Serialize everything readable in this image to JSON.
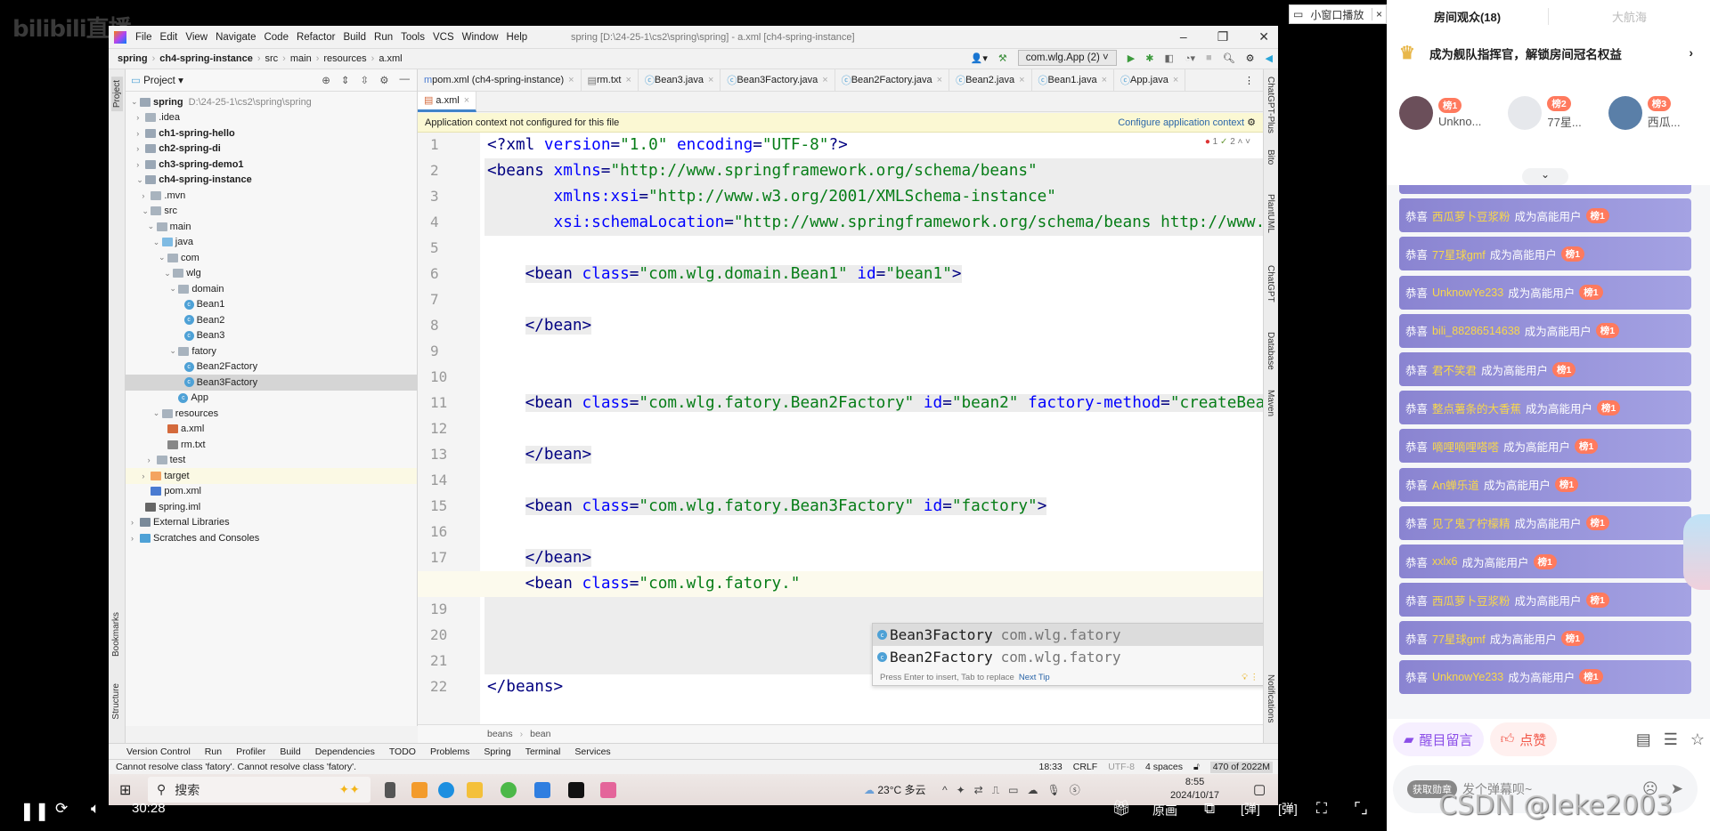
{
  "overlay": {
    "logo": "bilibili直播",
    "pip_label": "小窗口播放",
    "pip_close": "×",
    "watermark": "CSDN @leke2003"
  },
  "ide": {
    "menu": [
      "File",
      "Edit",
      "View",
      "Navigate",
      "Code",
      "Refactor",
      "Build",
      "Run",
      "Tools",
      "VCS",
      "Window",
      "Help"
    ],
    "title": "spring [D:\\24-25-1\\cs2\\spring\\spring] - a.xml [ch4-spring-instance]",
    "breadcrumb": [
      "spring",
      "ch4-spring-instance",
      "src",
      "main",
      "resources",
      "a.xml"
    ],
    "run_config": "com.wlg.App (2)",
    "project_header": "Project",
    "tree": [
      {
        "label": "spring",
        "hint": "D:\\24-25-1\\cs2\\spring\\spring",
        "lvl": 0,
        "arrow": "v",
        "icon": "module",
        "bold": true
      },
      {
        "label": ".idea",
        "lvl": 1,
        "arrow": ">",
        "icon": "folder"
      },
      {
        "label": "ch1-spring-hello",
        "lvl": 1,
        "arrow": ">",
        "icon": "module",
        "bold": true
      },
      {
        "label": "ch2-spring-di",
        "lvl": 1,
        "arrow": ">",
        "icon": "module",
        "bold": true
      },
      {
        "label": "ch3-spring-demo1",
        "lvl": 1,
        "arrow": ">",
        "icon": "module",
        "bold": true
      },
      {
        "label": "ch4-spring-instance",
        "lvl": 1,
        "arrow": "v",
        "icon": "module",
        "bold": true
      },
      {
        "label": ".mvn",
        "lvl": 2,
        "arrow": ">",
        "icon": "folder"
      },
      {
        "label": "src",
        "lvl": 2,
        "arrow": "v",
        "icon": "folder"
      },
      {
        "label": "main",
        "lvl": 3,
        "arrow": "v",
        "icon": "folder"
      },
      {
        "label": "java",
        "lvl": 4,
        "arrow": "v",
        "icon": "srcfolder"
      },
      {
        "label": "com",
        "lvl": 5,
        "arrow": "v",
        "icon": "package"
      },
      {
        "label": "wlg",
        "lvl": 6,
        "arrow": "v",
        "icon": "package"
      },
      {
        "label": "domain",
        "lvl": 7,
        "arrow": "v",
        "icon": "package"
      },
      {
        "label": "Bean1",
        "lvl": 8,
        "icon": "class"
      },
      {
        "label": "Bean2",
        "lvl": 8,
        "icon": "class"
      },
      {
        "label": "Bean3",
        "lvl": 8,
        "icon": "class"
      },
      {
        "label": "fatory",
        "lvl": 7,
        "arrow": "v",
        "icon": "package"
      },
      {
        "label": "Bean2Factory",
        "lvl": 8,
        "icon": "class"
      },
      {
        "label": "Bean3Factory",
        "lvl": 8,
        "icon": "class",
        "selected": true
      },
      {
        "label": "App",
        "lvl": 7,
        "icon": "class"
      },
      {
        "label": "resources",
        "lvl": 4,
        "arrow": "v",
        "icon": "resfolder"
      },
      {
        "label": "a.xml",
        "lvl": 5,
        "icon": "xml"
      },
      {
        "label": "rm.txt",
        "lvl": 5,
        "icon": "txt"
      },
      {
        "label": "test",
        "lvl": 3,
        "arrow": ">",
        "icon": "folder"
      },
      {
        "label": "target",
        "lvl": 2,
        "arrow": ">",
        "icon": "target",
        "target": true
      },
      {
        "label": "pom.xml",
        "lvl": 2,
        "icon": "maven"
      },
      {
        "label": "spring.iml",
        "lvl": 1,
        "icon": "iml"
      },
      {
        "label": "External Libraries",
        "lvl": 0,
        "arrow": ">",
        "icon": "libs"
      },
      {
        "label": "Scratches and Consoles",
        "lvl": 0,
        "arrow": ">",
        "icon": "scratch"
      }
    ],
    "tabs": [
      "pom.xml (ch4-spring-instance)",
      "rm.txt",
      "Bean3.java",
      "Bean3Factory.java",
      "Bean2Factory.java",
      "Bean2.java",
      "Bean1.java",
      "App.java"
    ],
    "active_tab": "a.xml",
    "banner": {
      "text": "Application context not configured for this file",
      "action": "Configure application context"
    },
    "inspections": {
      "errors": "1",
      "warnings": "2"
    },
    "code": [
      [
        [
          "pun",
          "<?"
        ],
        [
          "tag",
          "xml "
        ],
        [
          "attr",
          "version"
        ],
        [
          "pun",
          "="
        ],
        [
          "val",
          "\"1.0\" "
        ],
        [
          "attr",
          "encoding"
        ],
        [
          "pun",
          "="
        ],
        [
          "val",
          "\"UTF-8\""
        ],
        [
          "pun",
          "?>"
        ]
      ],
      [
        [
          "tag",
          "<beans "
        ],
        [
          "attr",
          "xmlns"
        ],
        [
          "pun",
          "="
        ],
        [
          "val",
          "\"http://www.springframework.org/schema/beans\""
        ]
      ],
      [
        [
          "tag",
          "       "
        ],
        [
          "attr",
          "xmlns:xsi"
        ],
        [
          "pun",
          "="
        ],
        [
          "val",
          "\"http://www.w3.org/2001/XMLSchema-instance\""
        ]
      ],
      [
        [
          "tag",
          "       "
        ],
        [
          "attr",
          "xsi:schemaLocation"
        ],
        [
          "pun",
          "="
        ],
        [
          "val",
          "\"http://www.springframework.org/schema/beans http://www.s"
        ]
      ],
      [],
      [
        [
          "tag",
          "    <bean "
        ],
        [
          "attr",
          "class"
        ],
        [
          "pun",
          "="
        ],
        [
          "val",
          "\"com.wlg.domain.Bean1\" "
        ],
        [
          "attr",
          "id"
        ],
        [
          "pun",
          "="
        ],
        [
          "val",
          "\"bean1\""
        ],
        [
          "tag",
          ">"
        ]
      ],
      [],
      [
        [
          "tag",
          "    </bean>"
        ]
      ],
      [],
      [],
      [
        [
          "tag",
          "    <bean "
        ],
        [
          "attr",
          "class"
        ],
        [
          "pun",
          "="
        ],
        [
          "val",
          "\"com.wlg.fatory.Bean2Factory\" "
        ],
        [
          "attr",
          "id"
        ],
        [
          "pun",
          "="
        ],
        [
          "val",
          "\"bean2\" "
        ],
        [
          "attr",
          "factory-method"
        ],
        [
          "pun",
          "="
        ],
        [
          "val",
          "\"createBean"
        ]
      ],
      [],
      [
        [
          "tag",
          "    </bean>"
        ]
      ],
      [],
      [
        [
          "tag",
          "    <bean "
        ],
        [
          "attr",
          "class"
        ],
        [
          "pun",
          "="
        ],
        [
          "val",
          "\"com.wlg.fatory.Bean3Factory\" "
        ],
        [
          "attr",
          "id"
        ],
        [
          "pun",
          "="
        ],
        [
          "val",
          "\"factory\""
        ],
        [
          "tag",
          ">"
        ]
      ],
      [],
      [
        [
          "tag",
          "    </bean>"
        ]
      ],
      [
        [
          "tag",
          "    <bean "
        ],
        [
          "attr",
          "class"
        ],
        [
          "pun",
          "="
        ],
        [
          "val",
          "\"com.wlg.fatory.\""
        ]
      ],
      [],
      [],
      [],
      [
        [
          "tag",
          "</beans>"
        ]
      ]
    ],
    "completion": {
      "items": [
        {
          "name": "Bean3Factory",
          "pkg": "com.wlg.fatory"
        },
        {
          "name": "Bean2Factory",
          "pkg": "com.wlg.fatory"
        }
      ],
      "footer": "Press Enter to insert, Tab to replace",
      "next_tip": "Next Tip"
    },
    "editor_breadcrumb": [
      "beans",
      "bean"
    ],
    "left_stripe": [
      "Project",
      "Bookmarks",
      "Structure"
    ],
    "right_stripe": [
      "ChatGPT-Plus",
      "Bito",
      "PlantUML",
      "ChatGPT",
      "Database",
      "Maven",
      "Notifications"
    ],
    "tool_windows": [
      "Version Control",
      "Run",
      "Profiler",
      "Build",
      "Dependencies",
      "TODO",
      "Problems",
      "Spring",
      "Terminal",
      "Services"
    ],
    "status": {
      "message": "Cannot resolve class 'fatory'. Cannot resolve class 'fatory'.",
      "position": "18:33",
      "line_sep": "CRLF",
      "encoding": "UTF-8",
      "indent": "4 spaces",
      "memory": "470 of 2022M"
    }
  },
  "taskbar": {
    "search": "搜索",
    "weather": "23°C 多云",
    "time": "8:55",
    "date": "2024/10/17"
  },
  "video": {
    "time": "30:28",
    "quality": "原画"
  },
  "live": {
    "tabs": [
      "房间观众(18)",
      "大航海"
    ],
    "fleet_banner": "成为舰队指挥官，解锁房间冠名权益",
    "top3": [
      {
        "rank": "榜1",
        "name": "Unkno..."
      },
      {
        "rank": "榜2",
        "name": "77星..."
      },
      {
        "rank": "榜3",
        "name": "西瓜..."
      }
    ],
    "feed_prefix": "恭喜",
    "feed_suffix": "成为高能用户",
    "feed": [
      {
        "user": "",
        "badge": "榜1"
      },
      {
        "user": "西瓜萝卜豆浆粉",
        "badge": "榜1"
      },
      {
        "user": "77星球gmf",
        "badge": "榜1"
      },
      {
        "user": "UnknowYe233",
        "badge": "榜1"
      },
      {
        "user": "bili_88286514638",
        "badge": "榜1"
      },
      {
        "user": "君不笑君",
        "badge": "榜1"
      },
      {
        "user": "整点薯条的大香蕉",
        "badge": "榜1"
      },
      {
        "user": "嘀哩嘀哩嗒嗒",
        "badge": "榜1"
      },
      {
        "user": "An蝉乐道",
        "badge": "榜1"
      },
      {
        "user": "见了鬼了柠檬精",
        "badge": "榜1"
      },
      {
        "user": "xxlx6",
        "badge": "榜1"
      },
      {
        "user": "西瓜萝卜豆浆粉",
        "badge": "榜1"
      },
      {
        "user": "77星球gmf",
        "badge": "榜1"
      },
      {
        "user": "UnknowYe233",
        "badge": "榜1"
      }
    ],
    "actions": {
      "message": "醒目留言",
      "like": "点赞"
    },
    "input": {
      "medal": "获取勋章",
      "placeholder": "发个弹幕呗~"
    }
  }
}
